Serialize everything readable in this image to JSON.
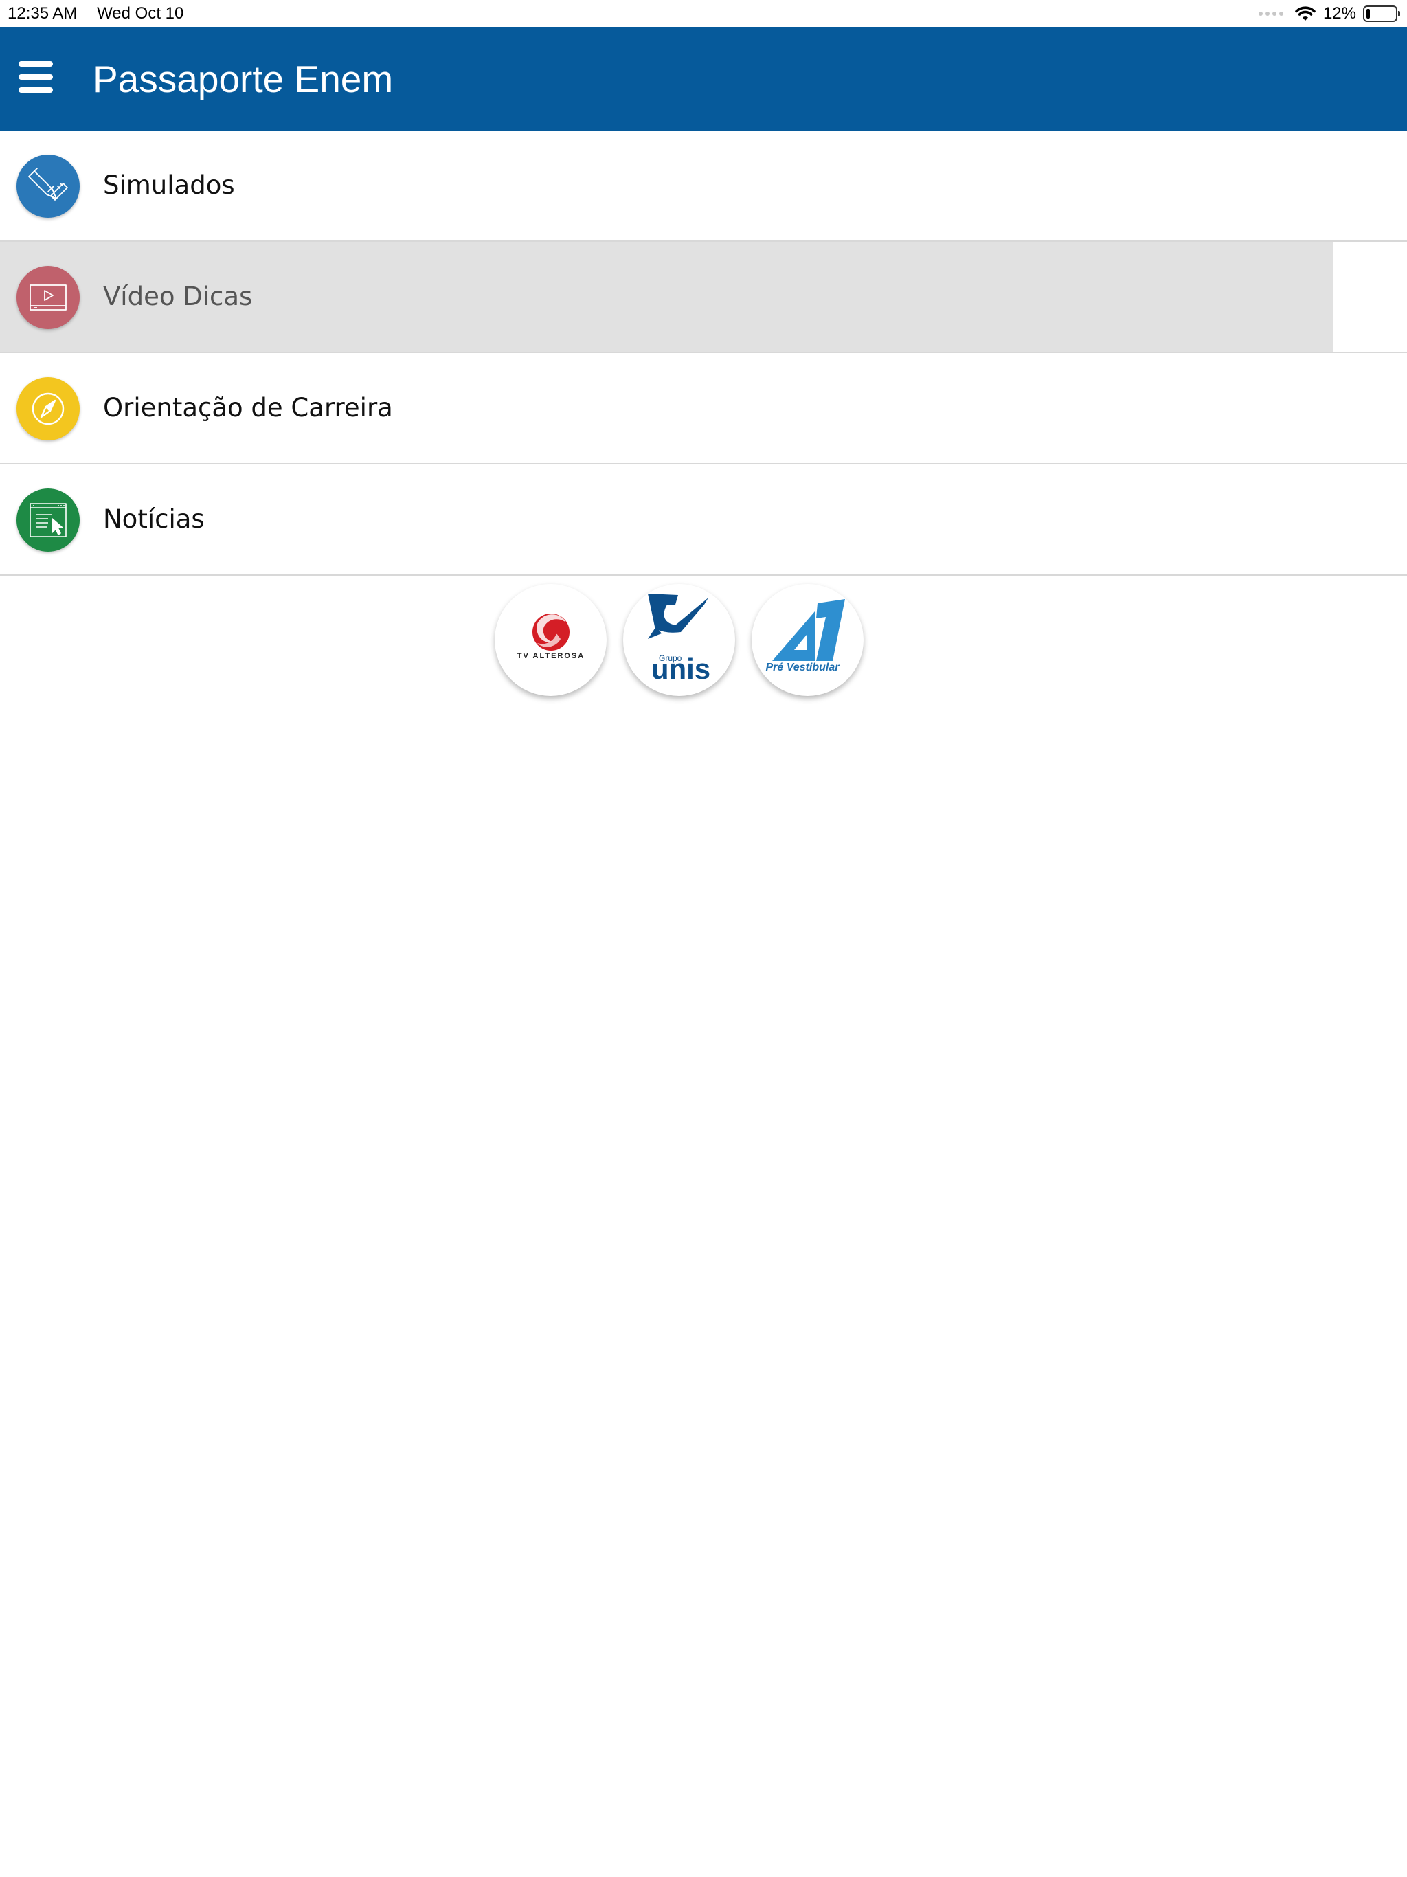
{
  "status_bar": {
    "time": "12:35 AM",
    "date": "Wed Oct 10",
    "battery_percent": "12%",
    "battery_level": 0.12,
    "icons": [
      "cellular-dots-icon",
      "wifi-icon",
      "battery-icon"
    ]
  },
  "header": {
    "title": "Passaporte Enem",
    "menu_icon": "hamburger-menu-icon",
    "background_color": "#065a9b"
  },
  "menu": {
    "items": [
      {
        "label": "Simulados",
        "icon": "pencil-ruler-icon",
        "icon_color": "#2a78b8",
        "active": false
      },
      {
        "label": "Vídeo Dicas",
        "icon": "video-player-icon",
        "icon_color": "#c0616c",
        "active": true
      },
      {
        "label": "Orientação de Carreira",
        "icon": "compass-icon",
        "icon_color": "#f3c61f",
        "active": false
      },
      {
        "label": "Notícias",
        "icon": "news-browser-icon",
        "icon_color": "#1e8a45",
        "active": false
      }
    ]
  },
  "sponsors": {
    "items": [
      {
        "name": "tv-alterosa-logo",
        "text": "TV ALTEROSA"
      },
      {
        "name": "grupo-unis-logo",
        "text_small": "Grupo",
        "text_big": "unis"
      },
      {
        "name": "a1-pre-vestibular-logo",
        "text": "Pré Vestibular"
      }
    ]
  }
}
